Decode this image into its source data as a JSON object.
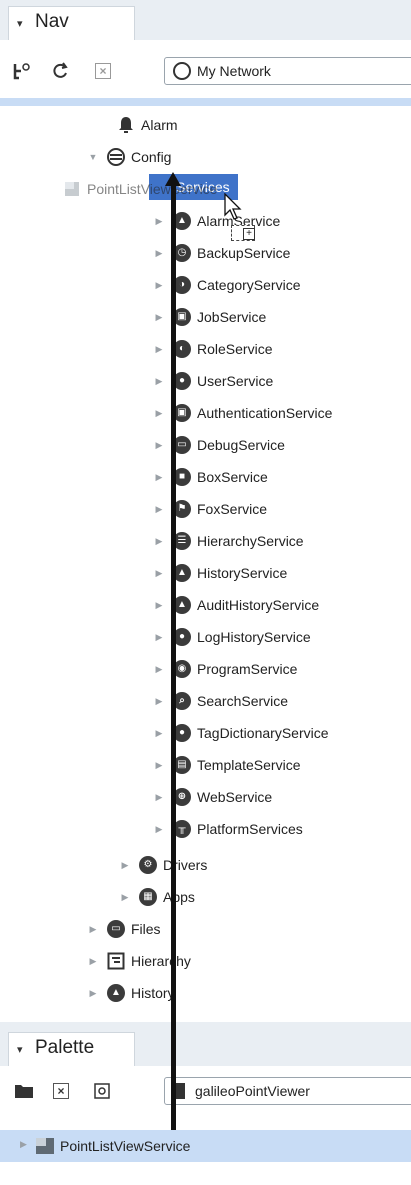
{
  "nav": {
    "title": "Nav",
    "address": "My Network",
    "tree": {
      "alarm": "Alarm",
      "config": "Config",
      "dragged_item": "PointListViewService",
      "services": "Services",
      "service_items": [
        {
          "label": "AlarmService",
          "icon": "alarm-service-icon"
        },
        {
          "label": "BackupService",
          "icon": "backup-service-icon"
        },
        {
          "label": "CategoryService",
          "icon": "category-service-icon"
        },
        {
          "label": "JobService",
          "icon": "job-service-icon"
        },
        {
          "label": "RoleService",
          "icon": "role-service-icon"
        },
        {
          "label": "UserService",
          "icon": "user-service-icon"
        },
        {
          "label": "AuthenticationService",
          "icon": "authentication-service-icon"
        },
        {
          "label": "DebugService",
          "icon": "debug-service-icon"
        },
        {
          "label": "BoxService",
          "icon": "box-service-icon"
        },
        {
          "label": "FoxService",
          "icon": "fox-service-icon"
        },
        {
          "label": "HierarchyService",
          "icon": "hierarchy-service-icon"
        },
        {
          "label": "HistoryService",
          "icon": "history-service-icon"
        },
        {
          "label": "AuditHistoryService",
          "icon": "audit-history-service-icon"
        },
        {
          "label": "LogHistoryService",
          "icon": "log-history-service-icon"
        },
        {
          "label": "ProgramService",
          "icon": "program-service-icon"
        },
        {
          "label": "SearchService",
          "icon": "search-service-icon"
        },
        {
          "label": "TagDictionaryService",
          "icon": "tag-dictionary-service-icon"
        },
        {
          "label": "TemplateService",
          "icon": "template-service-icon"
        },
        {
          "label": "WebService",
          "icon": "web-service-icon"
        },
        {
          "label": "PlatformServices",
          "icon": "platform-services-icon"
        }
      ],
      "drivers": "Drivers",
      "apps": "Apps",
      "files": "Files",
      "hierarchy": "Hierarchy",
      "history": "History"
    }
  },
  "palette": {
    "title": "Palette",
    "module": "galileoPointViewer",
    "item": "PointListViewService"
  },
  "colors": {
    "selection": "#3f73c9",
    "highlight_row": "#c8dcf5",
    "panel_bg": "#e9eef3"
  }
}
